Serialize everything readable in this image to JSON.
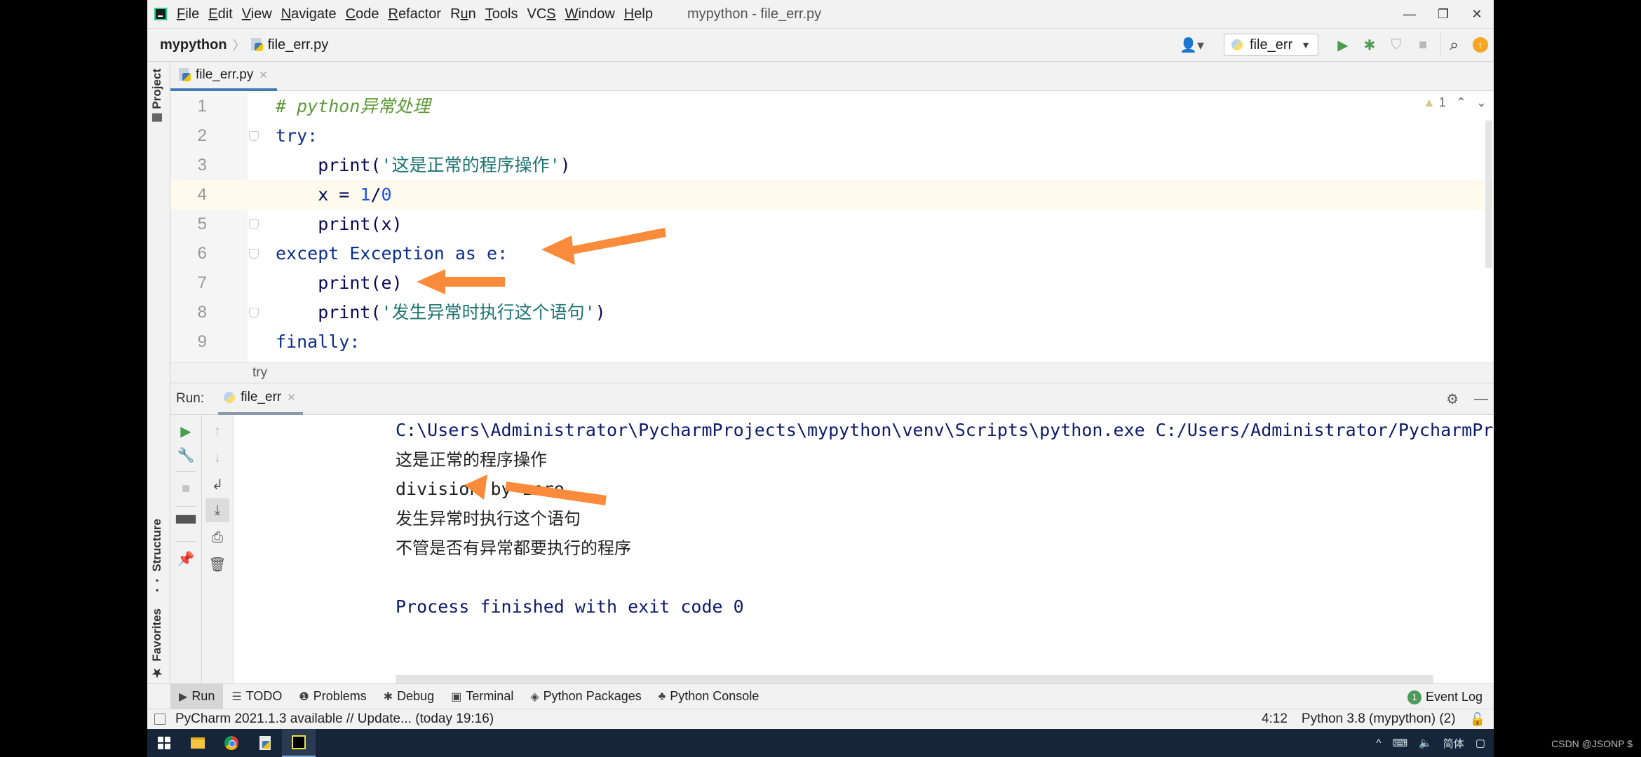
{
  "window": {
    "title": "mypython - file_err.py",
    "menu": [
      {
        "pre": "",
        "u": "F",
        "post": "ile"
      },
      {
        "pre": "",
        "u": "E",
        "post": "dit"
      },
      {
        "pre": "",
        "u": "V",
        "post": "iew"
      },
      {
        "pre": "",
        "u": "N",
        "post": "avigate"
      },
      {
        "pre": "",
        "u": "C",
        "post": "ode"
      },
      {
        "pre": "",
        "u": "R",
        "post": "efactor"
      },
      {
        "pre": "R",
        "u": "u",
        "post": "n"
      },
      {
        "pre": "",
        "u": "T",
        "post": "ools"
      },
      {
        "pre": "VC",
        "u": "S",
        "post": ""
      },
      {
        "pre": "",
        "u": "W",
        "post": "indow"
      },
      {
        "pre": "",
        "u": "H",
        "post": "elp"
      }
    ],
    "controls": {
      "minimize": "—",
      "restore": "❐",
      "close": "✕"
    }
  },
  "navbar": {
    "project": "mypython",
    "file": "file_err.py",
    "run_config": "file_err",
    "icons": {
      "user": "👤▾",
      "run": "▶",
      "debug": "🐞",
      "coverage": "⛉",
      "stop": "■",
      "search": "🔍",
      "update": "↑"
    }
  },
  "side_tabs": {
    "project": "Project",
    "structure": "Structure",
    "favorites": "Favorites"
  },
  "editor": {
    "tab_label": "file_err.py",
    "inspection": {
      "warning_count": "1",
      "up": "⌃",
      "down": "⌄"
    },
    "current_line": 4,
    "lines": [
      {
        "n": "1",
        "tokens": [
          {
            "t": "# python异常处理",
            "c": "cmt"
          }
        ]
      },
      {
        "n": "2",
        "tokens": [
          {
            "t": "try:",
            "c": "kw"
          }
        ],
        "fold": true
      },
      {
        "n": "3",
        "tokens": [
          {
            "t": "    print(",
            "c": ""
          },
          {
            "t": "'这是正常的程序操作'",
            "c": "str"
          },
          {
            "t": ")",
            "c": ""
          }
        ]
      },
      {
        "n": "4",
        "tokens": [
          {
            "t": "    x = ",
            "c": ""
          },
          {
            "t": "1",
            "c": "num"
          },
          {
            "t": "/",
            "c": ""
          },
          {
            "t": "0",
            "c": "num"
          }
        ]
      },
      {
        "n": "5",
        "tokens": [
          {
            "t": "    print(x)",
            "c": ""
          }
        ],
        "fold": true
      },
      {
        "n": "6",
        "tokens": [
          {
            "t": "except Exception as e:",
            "c": "kw"
          }
        ],
        "fold": true
      },
      {
        "n": "7",
        "tokens": [
          {
            "t": "    print(e)",
            "c": ""
          }
        ]
      },
      {
        "n": "8",
        "tokens": [
          {
            "t": "    print(",
            "c": ""
          },
          {
            "t": "'发生异常时执行这个语句'",
            "c": "str"
          },
          {
            "t": ")",
            "c": ""
          }
        ],
        "fold": true
      },
      {
        "n": "9",
        "tokens": [
          {
            "t": "finally:",
            "c": "kw"
          }
        ]
      }
    ],
    "breadcrumb": "try"
  },
  "run_panel": {
    "label": "Run:",
    "tab": "file_err",
    "output": [
      {
        "text": "C:\\Users\\Administrator\\PycharmProjects\\mypython\\venv\\Scripts\\python.exe C:/Users/Administrator/PycharmProjects/",
        "style": "mono blue"
      },
      {
        "text": "这是正常的程序操作",
        "style": "cn"
      },
      {
        "text": "division by zero",
        "style": "mono"
      },
      {
        "text": "发生异常时执行这个语句",
        "style": "cn"
      },
      {
        "text": "不管是否有异常都要执行的程序",
        "style": "cn"
      },
      {
        "text": "",
        "style": "mono"
      },
      {
        "text": "Process finished with exit code 0",
        "style": "mono blue"
      }
    ]
  },
  "tool_windows": [
    {
      "icon": "▶",
      "label": "Run",
      "active": true
    },
    {
      "icon": "☰",
      "label": "TODO"
    },
    {
      "icon": "❶",
      "label": "Problems"
    },
    {
      "icon": "✱",
      "label": "Debug"
    },
    {
      "icon": "▣",
      "label": "Terminal"
    },
    {
      "icon": "◈",
      "label": "Python Packages"
    },
    {
      "icon": "♣",
      "label": "Python Console"
    }
  ],
  "event_log": {
    "count": "1",
    "label": "Event Log"
  },
  "status": {
    "message": "PyCharm 2021.1.3 available // Update... (today 19:16)",
    "position": "4:12",
    "interpreter": "Python 3.8 (mypython) (2)"
  },
  "taskbar": {
    "tray": {
      "chevron": "^",
      "network": "⌨",
      "volume": "🔈",
      "ime": "简体",
      "notifications": "▢"
    }
  },
  "watermark": "CSDN @JSONP $",
  "colors": {
    "accent": "#3f7cb5",
    "annotation_arrow": "#f98b3a",
    "run_green": "#4a9c4f"
  }
}
